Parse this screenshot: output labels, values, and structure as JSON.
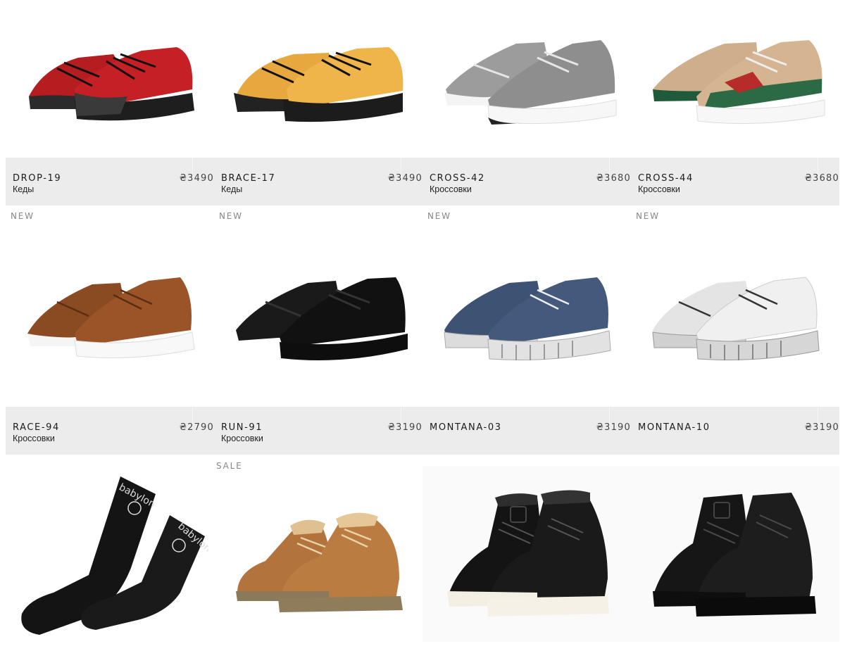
{
  "products": [
    {
      "name": "DROP-19",
      "price": "₴3490",
      "type": "Кеды",
      "badge": "NEW",
      "icon": "red-sneaker"
    },
    {
      "name": "BRACE-17",
      "price": "₴3490",
      "type": "Кеды",
      "badge": "NEW",
      "icon": "yellow-sneaker"
    },
    {
      "name": "CROSS-42",
      "price": "₴3680",
      "type": "Кроссовки",
      "badge": "NEW",
      "icon": "grey-running-shoe"
    },
    {
      "name": "CROSS-44",
      "price": "₴3680",
      "type": "Кроссовки",
      "badge": "NEW",
      "icon": "beige-green-running-shoe"
    },
    {
      "name": "RACE-94",
      "price": "₴2790",
      "type": "Кроссовки",
      "badge": "",
      "icon": "brown-suede-sneaker"
    },
    {
      "name": "RUN-91",
      "price": "₴3190",
      "type": "Кроссовки",
      "badge": "SALE",
      "icon": "black-running-shoe"
    },
    {
      "name": "MONTANA-03",
      "price": "₴3190",
      "type": "",
      "badge": "",
      "icon": "navy-canvas-sneaker"
    },
    {
      "name": "MONTANA-10",
      "price": "₴3190",
      "type": "",
      "badge": "",
      "icon": "white-canvas-sneaker"
    },
    {
      "icon": "black-socks",
      "logo_text": "babylon"
    },
    {
      "icon": "tan-fur-chukka-boot"
    },
    {
      "icon": "black-high-top-fur-sneaker"
    },
    {
      "icon": "black-high-top-leather-sneaker"
    }
  ],
  "colors": {
    "info_bg": "#ececec",
    "badge": "#888888"
  }
}
